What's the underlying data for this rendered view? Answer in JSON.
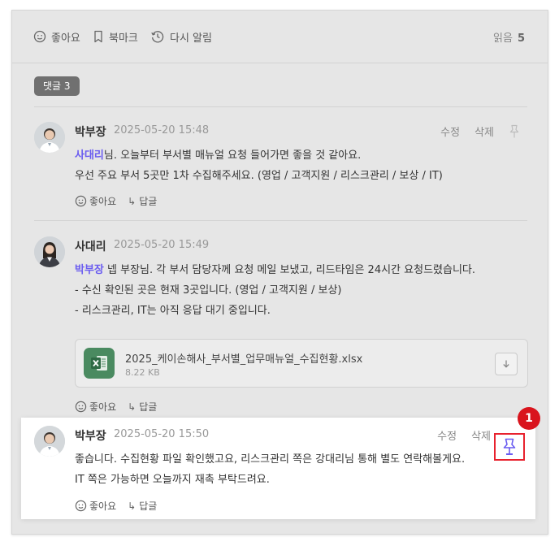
{
  "topbar": {
    "like_label": "좋아요",
    "bookmark_label": "북마크",
    "remind_label": "다시 알림",
    "reads_label": "읽음",
    "reads_count": "5"
  },
  "comments_badge": "댓글 3",
  "comments": [
    {
      "author": "박부장",
      "time": "2025-05-20 15:48",
      "edit": "수정",
      "delete": "삭제",
      "mention": "사대리",
      "line1_rest": "님. 오늘부터 부서별 매뉴얼 요청 들어가면 좋을 것 같아요.",
      "line2": "우선 주요 부서 5곳만 1차 수집해주세요. (영업 / 고객지원 / 리스크관리 / 보상 / IT)",
      "like": "좋아요",
      "reply": "답글"
    },
    {
      "author": "사대리",
      "time": "2025-05-20 15:49",
      "mention": "박부장",
      "line1_rest": " 넵 부장님. 각 부서 담당자께 요청 메일 보냈고, 리드타임은 24시간 요청드렸습니다.",
      "line2": "- 수신 확인된 곳은 현재 3곳입니다. (영업 / 고객지원 / 보상)",
      "line3": "- 리스크관리, IT는 아직 응답 대기 중입니다.",
      "file_name": "2025_케이손해사_부서별_업무매뉴얼_수집현황.xlsx",
      "file_size": "8.22 KB",
      "like": "좋아요",
      "reply": "답글"
    },
    {
      "author": "박부장",
      "time": "2025-05-20 15:50",
      "edit": "수정",
      "delete": "삭제",
      "line1": "좋습니다. 수집현황 파일 확인했고요, 리스크관리 쪽은 강대리님 통해 별도 연락해볼게요.",
      "line2": "IT 쪽은 가능하면 오늘까지 재촉 부탁드려요.",
      "like": "좋아요",
      "reply": "답글"
    }
  ],
  "marker": "1",
  "colors": {
    "mention": "#6a5cf0",
    "highlight": "#e8222e",
    "pin_active": "#6a5cf0",
    "excel": "#4a8a60"
  }
}
